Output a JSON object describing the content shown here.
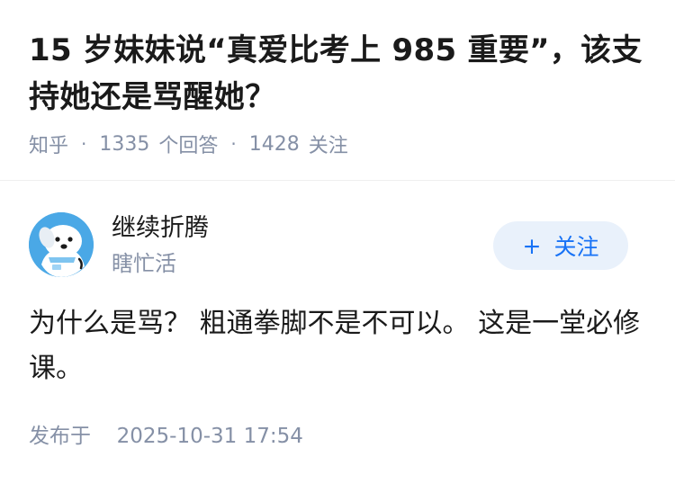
{
  "question": {
    "title": "15 岁妹妹说“真爱比考上 985 重要”，该支持她还是骂醒她？",
    "source": "知乎",
    "answers_count": "1335",
    "answers_label": "个回答",
    "followers_count": "1428",
    "followers_label": "关注",
    "separator": "·"
  },
  "author": {
    "name": "继续折腾",
    "headline": "瞎忙活",
    "avatar_icon": "cartoon-dog-avatar-icon",
    "follow_label": "关注",
    "follow_prefix": "+"
  },
  "answer": {
    "content": "为什么是骂？ 粗通拳脚不是不可以。 这是一堂必修课。",
    "published_label": "发布于",
    "published_time": "2025-10-31 17:54"
  },
  "colors": {
    "title_text": "#1a1a1a",
    "meta_text": "#8590a6",
    "follow_text": "#1772f6",
    "follow_bg": "#e9f1fb",
    "avatar_bg": "#4aa8e6"
  }
}
